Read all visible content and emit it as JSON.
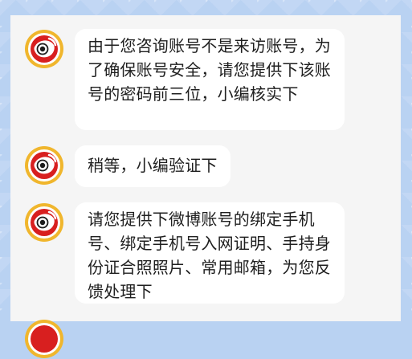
{
  "chat": {
    "messages": [
      {
        "text": "由于您咨询账号不是来访账号，为了确保账号安全，请您提供下该账号的密码前三位，小编核实下"
      },
      {
        "text": "稍等，小编验证下"
      },
      {
        "text": "请您提供下微博账号的绑定手机号、绑定手机号入网证明、手持身份证合照照片、常用邮箱，为您反馈处理下"
      }
    ]
  },
  "icons": {
    "avatar": "weibo-logo-avatar"
  },
  "colors": {
    "background": "#b9d2f2",
    "panel": "#f5f5f5",
    "bubble": "#ffffff",
    "avatar_outer": "#f0b62d",
    "avatar_red": "#d81f1f"
  }
}
